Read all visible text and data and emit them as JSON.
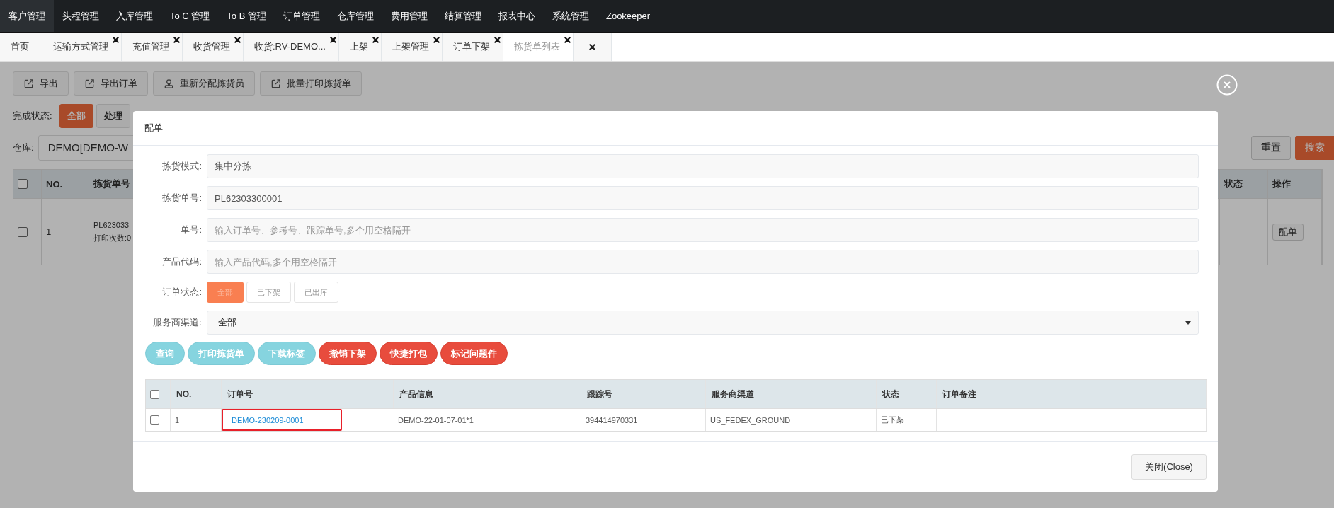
{
  "nav": {
    "items": [
      {
        "label": "客户管理",
        "selected": true
      },
      {
        "label": "头程管理",
        "selected": false
      },
      {
        "label": "入库管理",
        "selected": false
      },
      {
        "label": "To C 管理",
        "selected": false
      },
      {
        "label": "To B 管理",
        "selected": false
      },
      {
        "label": "订单管理",
        "selected": false
      },
      {
        "label": "仓库管理",
        "selected": false
      },
      {
        "label": "费用管理",
        "selected": false
      },
      {
        "label": "结算管理",
        "selected": false
      },
      {
        "label": "报表中心",
        "selected": false
      },
      {
        "label": "系统管理",
        "selected": false
      },
      {
        "label": "Zookeeper",
        "selected": false
      }
    ]
  },
  "tabs": [
    {
      "label": "首页",
      "selected": false,
      "closable": false
    },
    {
      "label": "运输方式管理",
      "selected": false,
      "closable": true
    },
    {
      "label": "充值管理",
      "selected": false,
      "closable": true
    },
    {
      "label": "收货管理",
      "selected": false,
      "closable": true
    },
    {
      "label": "收货:RV-DEMO...",
      "selected": false,
      "closable": true
    },
    {
      "label": "上架",
      "selected": false,
      "closable": true
    },
    {
      "label": "上架管理",
      "selected": false,
      "closable": true
    },
    {
      "label": "订单下架",
      "selected": false,
      "closable": true
    },
    {
      "label": "拣货单列表",
      "selected": true,
      "closable": true
    }
  ],
  "page": {
    "toolbar": [
      {
        "label": "导出",
        "kind": "export"
      },
      {
        "label": "导出订单",
        "kind": "export"
      },
      {
        "label": "重新分配拣货员",
        "kind": "user"
      },
      {
        "label": "批量打印拣货单",
        "kind": "export"
      }
    ],
    "status_filter": {
      "label": "完成状态:",
      "options": [
        {
          "label": "全部",
          "selected": true
        },
        {
          "label": "处理",
          "selected": false
        }
      ]
    },
    "warehouse": {
      "label": "仓库:",
      "value": "DEMO[DEMO-W"
    },
    "reset_button": "重置",
    "search_button": "搜索",
    "table": {
      "all_checked": false,
      "columns": [
        "NO.",
        "拣货单号",
        "状态",
        "操作"
      ],
      "rows": [
        {
          "checked": false,
          "no": "1",
          "pick_no": "PL623033",
          "print_count": "打印次数:0",
          "action": "配单"
        }
      ]
    }
  },
  "modal": {
    "title": "配单",
    "fields": [
      {
        "label": "拣货模式:",
        "kind": "text",
        "value": "集中分拣"
      },
      {
        "label": "拣货单号:",
        "kind": "text",
        "value": "PL62303300001"
      },
      {
        "label": "单号:",
        "kind": "text",
        "placeholder": "输入订单号、参考号、跟踪单号,多个用空格隔开"
      },
      {
        "label": "产品代码:",
        "kind": "text",
        "placeholder": "输入产品代码,多个用空格隔开"
      },
      {
        "label": "订单状态:",
        "kind": "choice",
        "options": [
          {
            "label": "全部",
            "selected": true
          },
          {
            "label": "已下架",
            "selected": false
          },
          {
            "label": "已出库",
            "selected": false
          }
        ]
      },
      {
        "label": "服务商渠道:",
        "kind": "select",
        "value": "全部"
      }
    ],
    "buttons": [
      {
        "label": "查询",
        "kind": "info"
      },
      {
        "label": "打印拣货单",
        "kind": "info"
      },
      {
        "label": "下载标签",
        "kind": "info"
      },
      {
        "label": "撤销下架",
        "kind": "danger"
      },
      {
        "label": "快捷打包",
        "kind": "danger"
      },
      {
        "label": "标记问题件",
        "kind": "danger"
      }
    ],
    "table": {
      "all_checked": false,
      "columns": [
        "NO.",
        "订单号",
        "产品信息",
        "跟踪号",
        "服务商渠道",
        "状态",
        "订单备注"
      ],
      "rows": [
        {
          "checked": false,
          "no": "1",
          "order_no": "DEMO-230209-0001",
          "highlighted": true,
          "product": "DEMO-22-01-07-01*1",
          "tracking": "394414970331",
          "channel": "US_FEDEX_GROUND",
          "status": "已下架"
        }
      ]
    },
    "close_button": "关闭(Close)"
  }
}
